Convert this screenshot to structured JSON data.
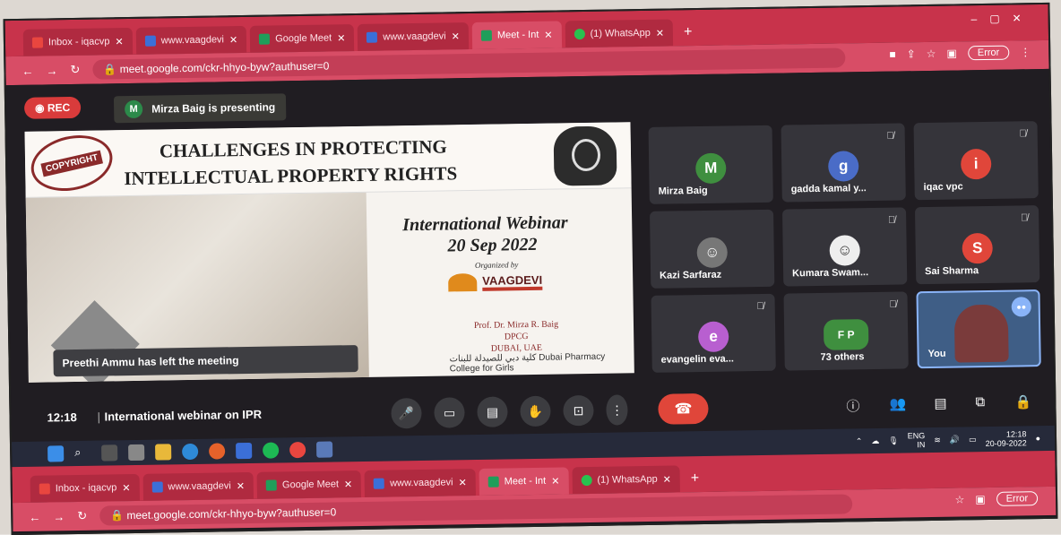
{
  "browser": {
    "tabs": [
      {
        "label": "Inbox - iqacvp",
        "icon": "gmail-icon"
      },
      {
        "label": "www.vaagdevi",
        "icon": "page-icon"
      },
      {
        "label": "Google Meet",
        "icon": "meet-icon"
      },
      {
        "label": "www.vaagdevi",
        "icon": "page-icon"
      },
      {
        "label": "Meet - Int",
        "icon": "meet-icon",
        "active": true
      },
      {
        "label": "(1) WhatsApp",
        "icon": "whatsapp-icon"
      }
    ],
    "url": "meet.google.com/ckr-hhyo-byw?authuser=0",
    "error_label": "Error"
  },
  "browser2": {
    "tabs": [
      {
        "label": "Inbox - iqacvp"
      },
      {
        "label": "www.vaagdevi"
      },
      {
        "label": "Google Meet"
      },
      {
        "label": "www.vaagdevi"
      },
      {
        "label": "Meet - Int"
      },
      {
        "label": "(1) WhatsApp"
      }
    ],
    "url": "meet.google.com/ckr-hhyo-byw?authuser=0",
    "error_label": "Error"
  },
  "meet": {
    "rec_label": "REC",
    "presenter_initial": "M",
    "presenting_text": "Mirza Baig is presenting",
    "toast": "Preethi Ammu has left the meeting",
    "clock": "12:18",
    "meeting_name": "International webinar on IPR"
  },
  "slide": {
    "stamp_text": "COPYRIGHT",
    "title_line1": "CHALLENGES IN PROTECTING",
    "title_line2": "INTELLECTUAL PROPERTY RIGHTS",
    "webinar": "International Webinar",
    "date": "20 Sep 2022",
    "organized_by": "Organized by",
    "org_name": "VAAGDEVI",
    "prof_line1": "Prof. Dr. Mirza R. Baig",
    "prof_line2": "DPCG",
    "prof_line3": "DUBAI, UAE",
    "footer": "كلية دبي للصيدلة للبنات  Dubai Pharmacy College for Girls"
  },
  "participants": [
    {
      "name": "Mirza Baig",
      "initial": "M",
      "color": "#3f8f3f",
      "muted": false
    },
    {
      "name": "gadda kamal y...",
      "initial": "g",
      "color": "#4a6cc7",
      "muted": true
    },
    {
      "name": "iqac vpc",
      "initial": "i",
      "color": "#e0463a",
      "muted": true
    },
    {
      "name": "Kazi Sarfaraz",
      "initial": "",
      "color": "#555",
      "muted": false
    },
    {
      "name": "Kumara Swam...",
      "initial": "",
      "color": "#eee",
      "muted": true
    },
    {
      "name": "Sai Sharma",
      "initial": "S",
      "color": "#e0463a",
      "muted": true
    },
    {
      "name": "evangelin eva...",
      "initial": "e",
      "color": "#b85fd0",
      "muted": true
    },
    {
      "name": "73 others",
      "initial": "F P",
      "color": "#3f8f3f",
      "muted": true
    },
    {
      "name": "You",
      "initial": "",
      "color": "#3f5e86",
      "muted": false
    }
  ],
  "taskbar": {
    "lang": "ENG",
    "region": "IN",
    "time": "12:18",
    "date": "20-09-2022"
  }
}
